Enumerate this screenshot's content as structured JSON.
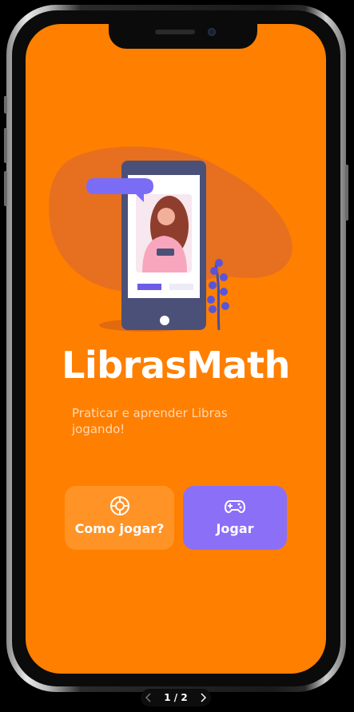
{
  "app": {
    "title": "LibrasMath",
    "subtitle": "Praticar e aprender Libras jogando!"
  },
  "actions": {
    "how_to_play": {
      "label": "Como jogar?",
      "icon": "lifebuoy-icon"
    },
    "play": {
      "label": "Jogar",
      "icon": "gamepad-icon"
    }
  },
  "pager": {
    "text": "1 / 2"
  },
  "colors": {
    "background": "#FF7F00",
    "secondary_button": "#FF9326",
    "primary_button": "#8C6FF7",
    "subtitle": "#FFD9B3",
    "device_frame": "#4B5078"
  }
}
